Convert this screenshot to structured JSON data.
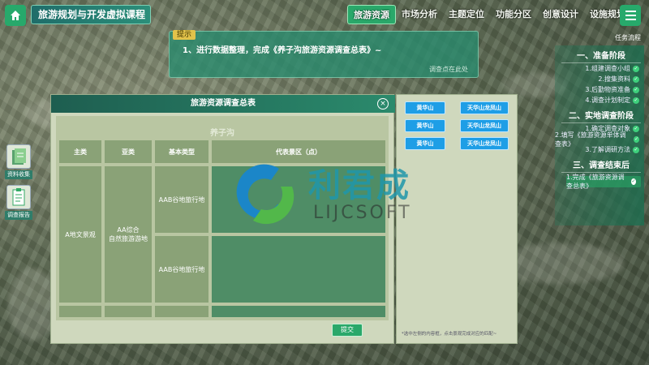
{
  "header": {
    "title": "旅游规划与开发虚拟课程",
    "nav": [
      "旅游资源",
      "市场分析",
      "主题定位",
      "功能分区",
      "创意设计",
      "设施规划"
    ],
    "active_index": 0,
    "accent": "#2aa86a"
  },
  "hint": {
    "tag": "提示",
    "text": "1、进行数据整理，完成《养子沟旅游资源调查总表》~",
    "link": "调查点在此处"
  },
  "tasks": {
    "header": "任务流程",
    "sections": [
      {
        "title": "一、准备阶段",
        "items": [
          "1.组建调查小组",
          "2.搜集资料",
          "3.后勤物资准备",
          "4.调查计划制定"
        ]
      },
      {
        "title": "二、实地调查阶段",
        "items": [
          "1.确定调查对象",
          "2.填写《旅游资源单体调查表》",
          "3.了解调研方法"
        ]
      },
      {
        "title": "三、调查结束后",
        "items": [
          "1.完成《旅游资源调查总表》"
        ]
      }
    ]
  },
  "tools": [
    {
      "label": "资料收集"
    },
    {
      "label": "调查报告"
    }
  ],
  "dialog": {
    "title": "旅游资源调查总表",
    "close": "×",
    "table_title": "养子沟",
    "headers": [
      "主类",
      "亚类",
      "基本类型",
      "代表景区（点）"
    ],
    "main_class": "A地文景观",
    "sub_class_line1": "AA综合",
    "sub_class_line2": "自然旅游游地",
    "basic_type_1": "AAB谷地旅行地",
    "basic_type_2": "AAB谷地旅行地",
    "submit": "提交"
  },
  "selector": {
    "spots": [
      "黄华山",
      "天华山龙凤山",
      "黄华山",
      "天华山龙凤山",
      "黄华山",
      "天华山龙凤山"
    ],
    "note": "*选中左侧的内容框，点击景观完成对应的匹配~",
    "spot_color": "#1e9ee6"
  },
  "watermark": {
    "text": "利君成",
    "sub": "LIJCSOFT"
  }
}
